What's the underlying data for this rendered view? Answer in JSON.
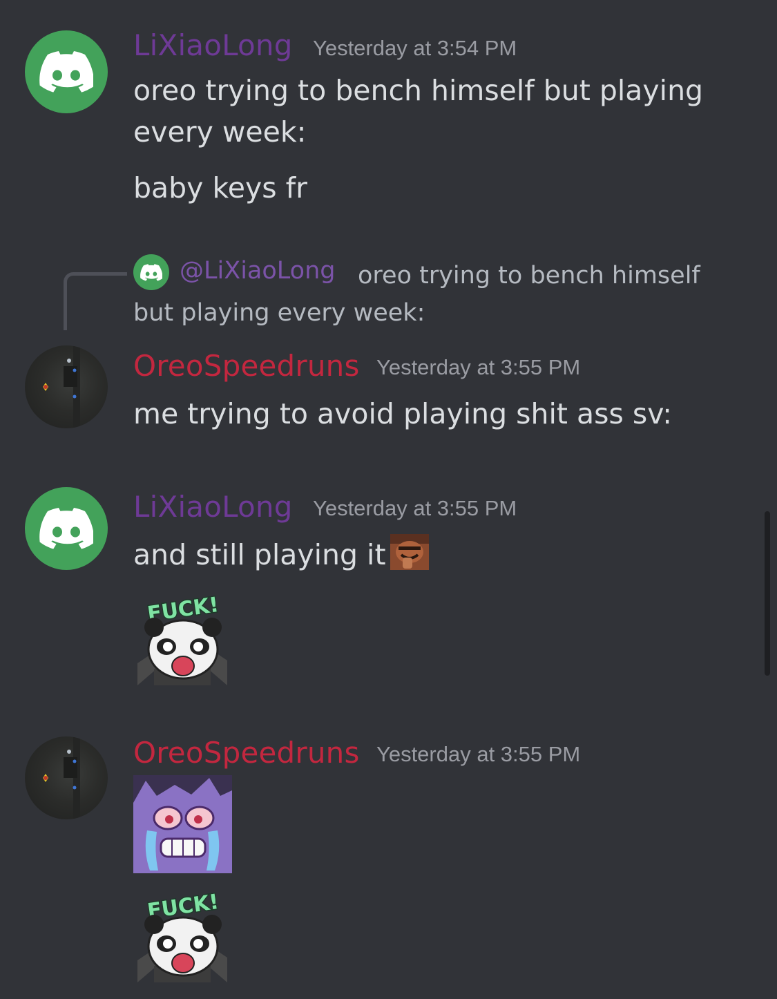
{
  "messages": [
    {
      "author": "LiXiaoLong",
      "timestamp": "Yesterday at 3:54 PM",
      "lines": [
        "oreo trying to bench himself but playing every week:",
        "baby keys fr"
      ]
    },
    {
      "reply_to": {
        "mention": "@LiXiaoLong",
        "text": "oreo trying to bench himself but playing every week:"
      },
      "author": "OreoSpeedruns",
      "timestamp": "Yesterday at 3:55 PM",
      "lines": [
        "me trying to avoid playing shit ass sv:"
      ]
    },
    {
      "author": "LiXiaoLong",
      "timestamp": "Yesterday at 3:55 PM",
      "lines": [
        "and still playing it"
      ],
      "inline_emoji": "laughing-man-emoji",
      "sticker": {
        "name": "panda-sticker",
        "caption": "FUCK!"
      }
    },
    {
      "author": "OreoSpeedruns",
      "timestamp": "Yesterday at 3:55 PM",
      "stickers": [
        {
          "name": "crying-gengar-emote"
        },
        {
          "name": "panda-sticker",
          "caption": "FUCK!"
        }
      ]
    }
  ],
  "colors": {
    "background": "#313338",
    "lixiaolong_name": "#6e3a96",
    "oreospeedruns_name": "#c3273f",
    "discord_avatar": "#43a25a",
    "message_text": "#dbdee1",
    "timestamp": "#9a9ca3"
  }
}
